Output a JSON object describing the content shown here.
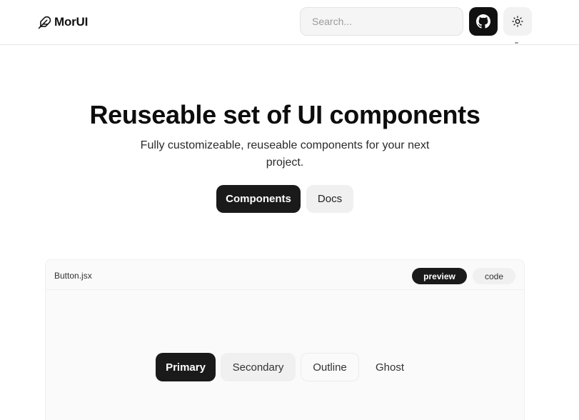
{
  "navbar": {
    "brand_name": "MorUI",
    "brand_icon": "feather-icon",
    "search_placeholder": "Search...",
    "github_icon": "github-icon",
    "theme_icon": "sun-icon"
  },
  "hero": {
    "title": "Reuseable set of UI components",
    "subtitle": "Fully customizeable, reuseable components for your next project.",
    "primary_cta": "Components",
    "secondary_cta": "Docs"
  },
  "demo_card": {
    "file_name": "Button.jsx",
    "tabs": {
      "preview": "preview",
      "code": "code"
    },
    "active_tab": "preview",
    "buttons": {
      "primary": "Primary",
      "secondary": "Secondary",
      "outline": "Outline",
      "ghost": "Ghost"
    }
  },
  "colors": {
    "primary": "#1a1a1a",
    "muted_bg": "#f0f0f0",
    "page_bg": "#ffffff"
  }
}
